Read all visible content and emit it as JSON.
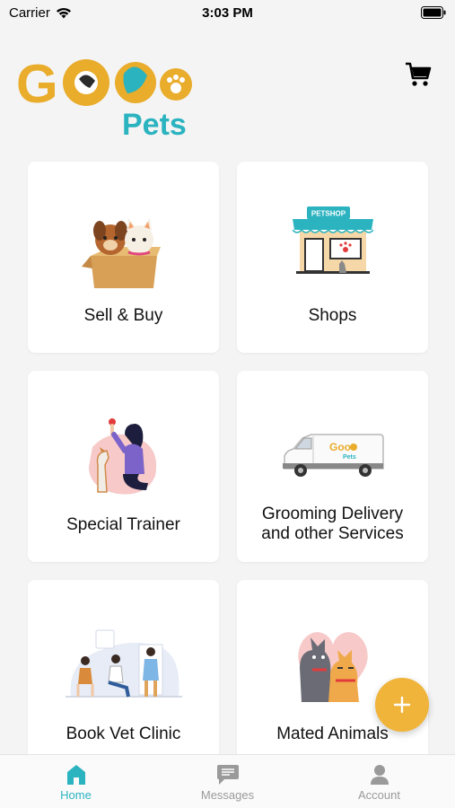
{
  "status_bar": {
    "carrier": "Carrier",
    "time": "3:03 PM"
  },
  "logo": {
    "letters": "GOoo",
    "sub": "Pets"
  },
  "cards": {
    "sell": "Sell & Buy",
    "shops": "Shops",
    "trainer": "Special Trainer",
    "grooming_line1": "Grooming Delivery",
    "grooming_line2": "and other Services",
    "vet": "Book Vet Clinic",
    "mated": "Mated Animals"
  },
  "shop_sign": "PETSHOP",
  "van_logo": {
    "letters": "Goo",
    "sub": "Pets"
  },
  "tabs": {
    "home": "Home",
    "messages": "Messages",
    "account": "Account"
  },
  "colors": {
    "accent": "#2bb3c0",
    "brand_yellow": "#e9ac2b",
    "fab": "#f0b43a",
    "inactive": "#9a9a9a"
  }
}
